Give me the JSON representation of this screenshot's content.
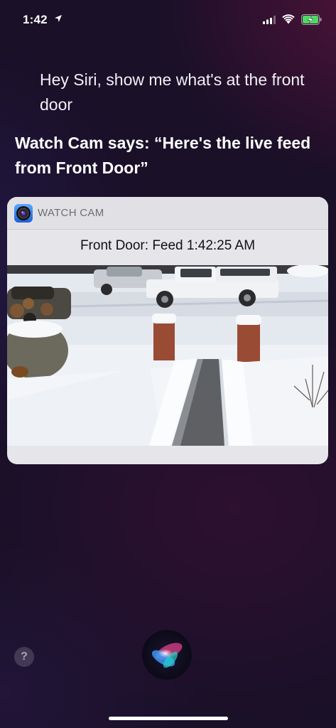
{
  "status_bar": {
    "time": "1:42"
  },
  "siri": {
    "query": "Hey Siri, show me what's at the front door",
    "response": "Watch Cam says: “Here's the live feed from Front Door”"
  },
  "card": {
    "app_name": "WATCH CAM",
    "feed_title": "Front Door: Feed 1:42:25 AM"
  },
  "help": {
    "label": "?"
  },
  "colors": {
    "background": "#1a1028",
    "card": "#e6e6ea",
    "battery_green": "#4cd964"
  },
  "icons": [
    "location-arrow-icon",
    "cellular-signal-icon",
    "wifi-icon",
    "battery-charging-icon",
    "watch-cam-app-icon",
    "siri-orb-icon"
  ]
}
